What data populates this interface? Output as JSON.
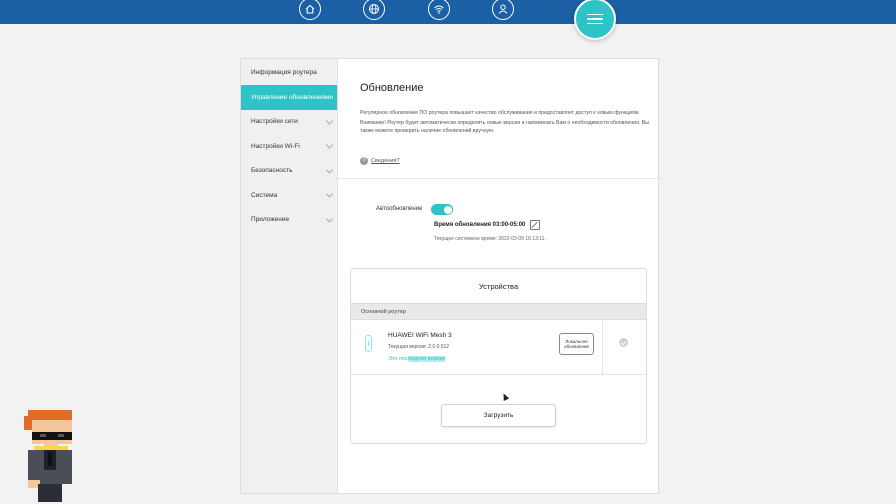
{
  "nav": {
    "icons": [
      "home-icon",
      "globe-icon",
      "wifi-icon",
      "user-icon"
    ],
    "menu_icon": "hamburger-menu-icon"
  },
  "colors": {
    "accent": "#2ec3c7",
    "topbar": "#1b5fa5"
  },
  "sidebar": {
    "items": [
      {
        "label": "Информация роутера",
        "active": false,
        "expandable": false
      },
      {
        "label": "Управление обновлениями",
        "active": true,
        "expandable": false
      },
      {
        "label": "Настройки сети",
        "active": false,
        "expandable": true
      },
      {
        "label": "Настройки Wi-Fi",
        "active": false,
        "expandable": true
      },
      {
        "label": "Безопасность",
        "active": false,
        "expandable": true
      },
      {
        "label": "Система",
        "active": false,
        "expandable": true
      },
      {
        "label": "Приложение",
        "active": false,
        "expandable": true
      }
    ]
  },
  "main": {
    "title": "Обновление",
    "description_1": "Регулярное обновление ПО роутера повышает качество обслуживания и предоставляет доступ к новым функциям.",
    "description_2": "Внимание! Роутер будет автоматически определять новые версии и напоминать Вам о необходимости обновления. Вы также можете проверить наличие обновлений вручную.",
    "details_link": "Сведения?",
    "auto_update_label": "Автообновление",
    "auto_update_on": true,
    "update_time": "Время обновления 03:00-05:00",
    "system_time": "Текущее системное время: 2022-03-09 16:13:11."
  },
  "devices": {
    "title": "Устройства",
    "group": "Основной роутер",
    "device_name": "HUAWEI WiFi Mesh 3",
    "current_version": "Текущая версия: 2.0.0.512",
    "latest_prefix": "Это пос",
    "latest_highlight": "ледняя версия",
    "local_update_button": "Локальное обновление",
    "upload_button": "Загрузить"
  }
}
